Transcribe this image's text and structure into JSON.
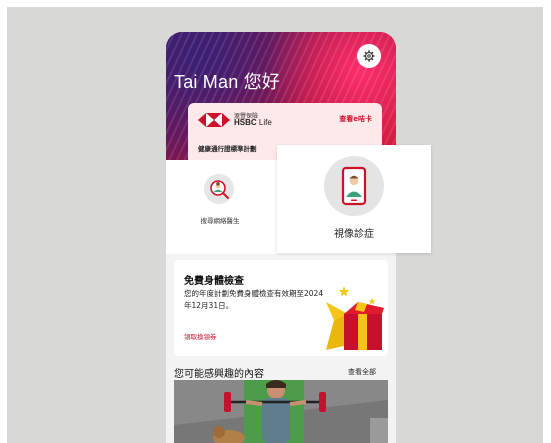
{
  "header": {
    "greeting": "Tai Man 您好"
  },
  "insurance_card": {
    "brand_line1": "滙豐保險",
    "brand_hsbc": "HSBC",
    "brand_life": "Life",
    "ecard_link": "查看e咭卡",
    "plan_name": "健康通行證標準計劃"
  },
  "services": {
    "search_doctor_label": "搜尋網絡醫生",
    "video_consult_label": "視像診症"
  },
  "checkup_promo": {
    "title": "免費身體檢查",
    "description": "您的年度計劃免費身體檢查有效期至2024年12月31日。",
    "link": "領取換領券"
  },
  "interest_section": {
    "title": "您可能感興趣的內容",
    "see_all": "查看全部"
  },
  "colors": {
    "brand_red": "#d0112b",
    "card_pink": "#fde8ea",
    "background_grey": "#d8d8d7"
  },
  "icons": [
    "gear-icon",
    "hsbc-logo-icon",
    "heart-icon",
    "doctor-search-icon",
    "phone-doctor-icon",
    "gift-box-icon"
  ]
}
